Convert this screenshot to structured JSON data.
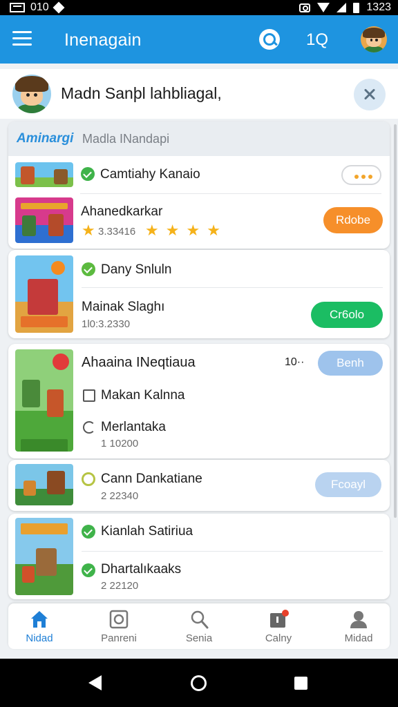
{
  "status_bar": {
    "left_text": "010",
    "time": "1323"
  },
  "app_bar": {
    "title": "Inenagain",
    "count_label": "1Q"
  },
  "greeting": {
    "text": "Madn Sanþl lahbliagal,"
  },
  "card1": {
    "tab_active": "Aminargi",
    "tab_inactive": "Madla INandapi",
    "rows": [
      {
        "title": "Camtiahy Kanaio"
      },
      {
        "title": "Ahanedkarkar",
        "rating": "3.33416",
        "button": "Rdobe"
      }
    ]
  },
  "card2": {
    "rows": [
      {
        "title": "Dany Snluln"
      },
      {
        "title": "Mainak Slaghı",
        "subtitle": "1l0:3.2330",
        "button": "Cr6olo"
      }
    ]
  },
  "card3": {
    "header_title": "Ahaaina INeqtiaua",
    "header_count": "10··",
    "header_button": "Benh",
    "rows": [
      {
        "title": "Makan Kalnna"
      },
      {
        "title": "Merlantaka",
        "subtitle": "1 10200"
      }
    ]
  },
  "card4": {
    "rows": [
      {
        "title": "Cann Dankatiane",
        "subtitle": "2 22340",
        "button": "Fcoayl"
      }
    ]
  },
  "card5": {
    "rows": [
      {
        "title": "Kianlah Satiriua"
      },
      {
        "title": "Dhartalıkaaks",
        "subtitle": "2 22120"
      }
    ]
  },
  "bottom_nav": {
    "items": [
      {
        "label": "Nidad",
        "icon": "home-icon",
        "active": true
      },
      {
        "label": "Panreni",
        "icon": "camera-icon",
        "active": false
      },
      {
        "label": "Senia",
        "icon": "search-icon",
        "active": false
      },
      {
        "label": "Calny",
        "icon": "notification-icon",
        "active": false
      },
      {
        "label": "Midad",
        "icon": "profile-icon",
        "active": false
      }
    ]
  },
  "colors": {
    "app_bar": "#1e94e0",
    "orange_button": "#f68f2a",
    "green_button": "#1bbd63",
    "blue_button": "#9ec3ec",
    "active_nav": "#1e7fd6"
  }
}
